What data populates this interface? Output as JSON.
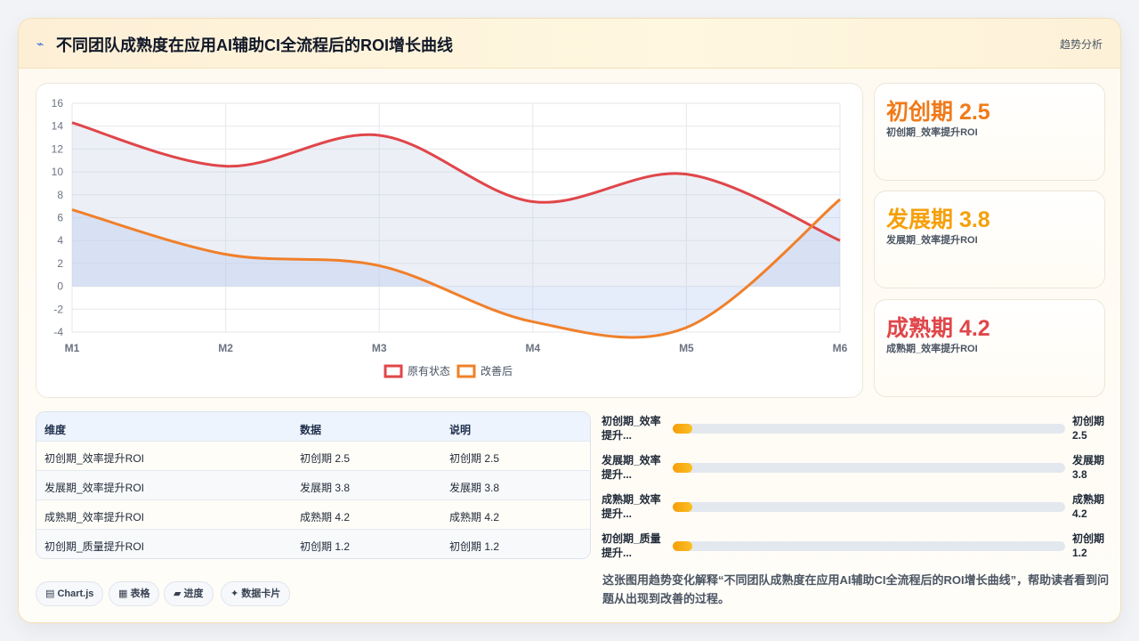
{
  "header": {
    "icon": "trend-line-icon",
    "title": "不同团队成熟度在应用AI辅助CI全流程后的ROI增长曲线",
    "badge": "趋势分析"
  },
  "colors": {
    "red": "#e0464a",
    "orange": "#f0802a",
    "amber": "#f5a00b",
    "bar": "#f59e0b"
  },
  "chart_data": {
    "type": "line",
    "categories": [
      "M1",
      "M2",
      "M3",
      "M4",
      "M5",
      "M6"
    ],
    "ylim": [
      -4,
      16
    ],
    "yticks": [
      "16",
      "14",
      "12",
      "10",
      "8",
      "6",
      "4",
      "2",
      "0",
      "-2",
      "-4"
    ],
    "grid": true,
    "legend_position": "bottom",
    "series": [
      {
        "name": "原有状态",
        "color": "#e0464a",
        "values": [
          14.3,
          10.5,
          13.2,
          7.4,
          9.8,
          4.0
        ]
      },
      {
        "name": "改善后",
        "color": "#f0802a",
        "values": [
          6.7,
          2.8,
          1.8,
          -3.1,
          -3.6,
          7.6
        ]
      }
    ]
  },
  "stats": [
    {
      "value": "初创期 2.5",
      "label": "初创期_效率提升ROI",
      "color": "#f07a1a"
    },
    {
      "value": "发展期 3.8",
      "label": "发展期_效率提升ROI",
      "color": "#f5a00b"
    },
    {
      "value": "成熟期 4.2",
      "label": "成熟期_效率提升ROI",
      "color": "#e0464a"
    }
  ],
  "table": {
    "headers": [
      "维度",
      "数据",
      "说明"
    ],
    "rows": [
      [
        "初创期_效率提升ROI",
        "初创期 2.5",
        "初创期 2.5"
      ],
      [
        "发展期_效率提升ROI",
        "发展期 3.8",
        "发展期 3.8"
      ],
      [
        "成熟期_效率提升ROI",
        "成熟期 4.2",
        "成熟期 4.2"
      ],
      [
        "初创期_质量提升ROI",
        "初创期 1.2",
        "初创期 1.2"
      ]
    ]
  },
  "progress": [
    {
      "label_l1": "初创期_效率",
      "label_l2": "提升...",
      "val_l1": "初创期",
      "val_l2": "2.5",
      "fraction": 0.05
    },
    {
      "label_l1": "发展期_效率",
      "label_l2": "提升...",
      "val_l1": "发展期",
      "val_l2": "3.8",
      "fraction": 0.05
    },
    {
      "label_l1": "成熟期_效率",
      "label_l2": "提升...",
      "val_l1": "成熟期",
      "val_l2": "4.2",
      "fraction": 0.05
    },
    {
      "label_l1": "初创期_质量",
      "label_l2": "提升...",
      "val_l1": "初创期",
      "val_l2": "1.2",
      "fraction": 0.05
    }
  ],
  "pills": [
    "▤ Chart.js",
    "▦ 表格",
    "▰ 进度",
    "✦ 数据卡片"
  ],
  "description": "这张图用趋势变化解释“不同团队成熟度在应用AI辅助CI全流程后的ROI增长曲线”，帮助读者看到问题从出现到改善的过程。"
}
